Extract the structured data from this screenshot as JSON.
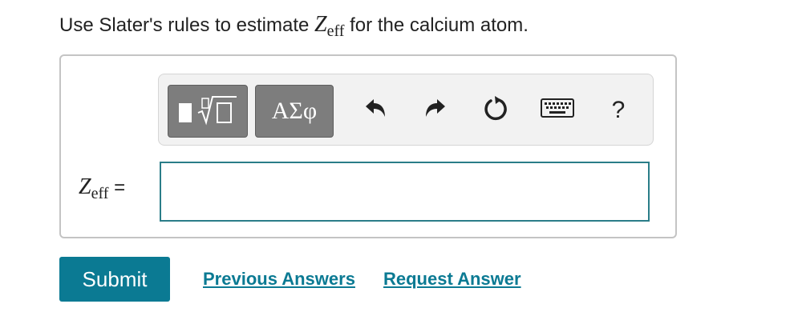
{
  "question": {
    "prefix": "Use Slater's rules to estimate ",
    "symbol": "Z",
    "subscript": "eff",
    "suffix": " for the calcium atom."
  },
  "toolbar": {
    "templates_icon": "templates-icon",
    "symbols_label": "ΑΣφ",
    "undo_icon": "undo-icon",
    "redo_icon": "redo-icon",
    "reset_icon": "reset-icon",
    "keyboard_icon": "keyboard-icon",
    "help_label": "?"
  },
  "answer": {
    "label_symbol": "Z",
    "label_subscript": "eff",
    "label_equals": " =",
    "value": "",
    "placeholder": ""
  },
  "actions": {
    "submit_label": "Submit",
    "previous_answers_label": "Previous Answers",
    "request_answer_label": "Request Answer"
  },
  "colors": {
    "accent": "#0b7a93",
    "input_border": "#2a7d88",
    "toolbar_button": "#7d7d7d"
  }
}
